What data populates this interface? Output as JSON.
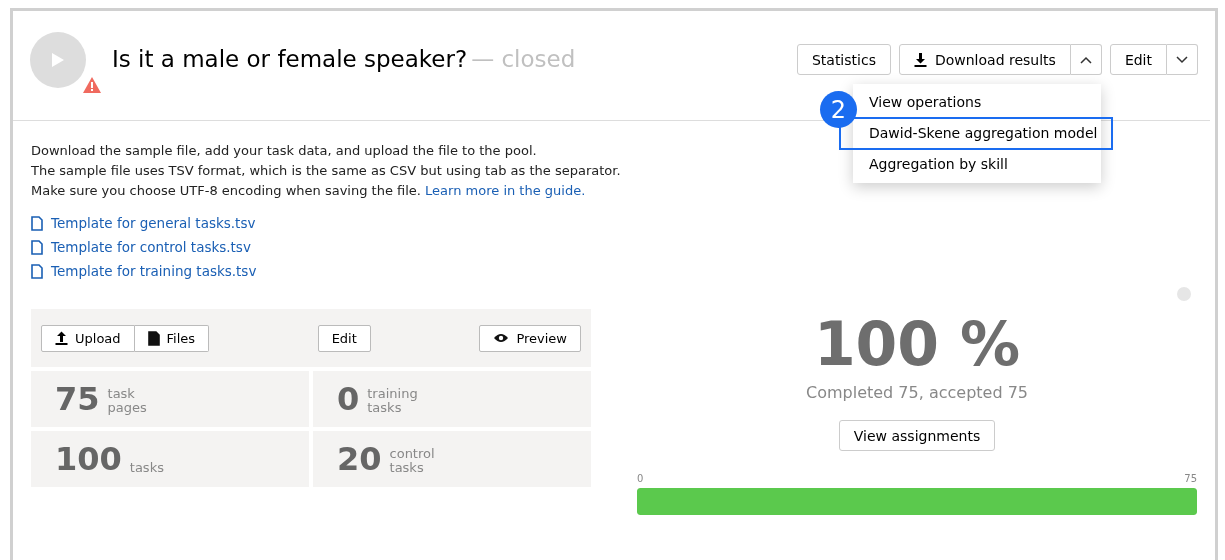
{
  "header": {
    "title": "Is it a male or female speaker?",
    "status": "— closed",
    "warning": true
  },
  "actions": [
    {
      "kind": "plain",
      "label": "Statistics"
    },
    {
      "kind": "split",
      "label": "Download results",
      "expanded": true
    },
    {
      "kind": "split",
      "label": "Edit",
      "expanded": false
    }
  ],
  "menu": {
    "callout": "2",
    "items": [
      {
        "label": "View operations",
        "highlighted": false
      },
      {
        "label": "Dawid-Skene aggregation model",
        "highlighted": true
      },
      {
        "label": "Aggregation by skill",
        "highlighted": false
      }
    ]
  },
  "intro": {
    "lines": [
      "Download the sample file, add your task data, and upload the file to the pool.",
      "The sample file uses TSV format, which is the same as CSV but using tab as the separator.",
      "Make sure you choose UTF-8 encoding when saving the file."
    ],
    "link": "Learn more in the guide."
  },
  "templates": [
    "Template for general tasks.tsv",
    "Template for control tasks.tsv",
    "Template for training tasks.tsv"
  ],
  "toolbar": {
    "upload": "Upload",
    "files": "Files",
    "edit": "Edit",
    "preview": "Preview"
  },
  "stats": [
    {
      "value": "75",
      "label": [
        "task",
        "pages"
      ]
    },
    {
      "value": "0",
      "label": [
        "training",
        "tasks"
      ]
    },
    {
      "value": "100",
      "label": [
        "tasks"
      ]
    },
    {
      "value": "20",
      "label": [
        "control",
        "tasks"
      ]
    }
  ],
  "progress": {
    "percent": "100 %",
    "summary": "Completed 75, accepted 75",
    "button": "View assignments",
    "min": "0",
    "max": "75",
    "level": 1
  }
}
